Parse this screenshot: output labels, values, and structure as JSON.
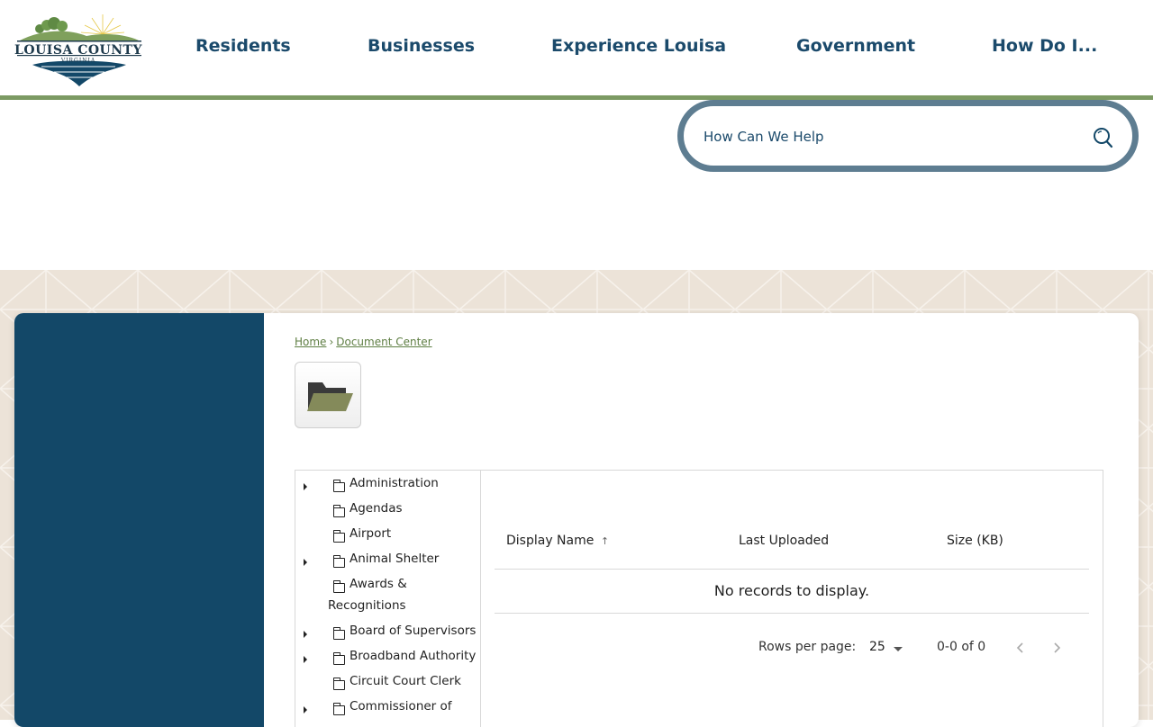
{
  "header": {
    "logo": {
      "name": "LOUISA COUNTY",
      "sub": "VIRGINIA"
    },
    "nav": [
      {
        "label": "Residents"
      },
      {
        "label": "Businesses"
      },
      {
        "label": "Experience Louisa"
      },
      {
        "label": "Government"
      },
      {
        "label": "How Do I..."
      }
    ]
  },
  "search": {
    "placeholder": "How Can We Help",
    "icon": "search-icon"
  },
  "breadcrumb": {
    "home": "Home",
    "separator": "›",
    "current": "Document Center"
  },
  "tree": {
    "items": [
      {
        "label": "Administration",
        "has_children": true
      },
      {
        "label": "Agendas",
        "has_children": false
      },
      {
        "label": "Airport",
        "has_children": false
      },
      {
        "label": "Animal Shelter",
        "has_children": true
      },
      {
        "label": "Awards &",
        "label2": "Recognitions",
        "has_children": false
      },
      {
        "label": "Board of Supervisors",
        "has_children": true
      },
      {
        "label": "Broadband Authority",
        "has_children": true
      },
      {
        "label": "Circuit Court Clerk",
        "has_children": false
      },
      {
        "label": "Commissioner of",
        "has_children": true
      }
    ]
  },
  "grid": {
    "columns": [
      "Display Name",
      "Last Uploaded",
      "Size (KB)"
    ],
    "sort_indicator": "↑",
    "empty_message": "No records to display.",
    "rows_per_page_label": "Rows per page:",
    "rows_per_page": "25",
    "range": "0-0 of 0"
  },
  "colors": {
    "navy": "#134868",
    "nav_text": "#1b4a6b",
    "green": "#7c9a63",
    "search_border": "#5e7d91",
    "band": "#ece3d8"
  }
}
